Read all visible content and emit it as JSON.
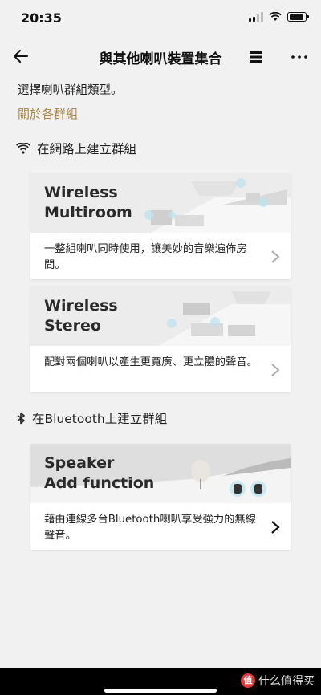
{
  "status": {
    "time": "20:35"
  },
  "nav": {
    "title": "與其他喇叭裝置集合"
  },
  "intro_text": "選擇喇叭群組類型。",
  "about_link": "關於各群組",
  "network_section": {
    "title": "在網路上建立群組",
    "cards": [
      {
        "name": "Wireless\nMultiroom",
        "description": "一整組喇叭同時使用，讓美妙的音樂遍佈房間。"
      },
      {
        "name": "Wireless\nStereo",
        "description": "配對兩個喇叭以產生更寬廣、更立體的聲音。"
      }
    ]
  },
  "bluetooth_section": {
    "title": "在Bluetooth上建立群組",
    "cards": [
      {
        "name": "Speaker\nAdd function",
        "description": "藉由連線多台Bluetooth喇叭享受強力的無線聲音。"
      }
    ]
  },
  "watermark": {
    "badge": "值",
    "text": "什么值得买"
  },
  "colors": {
    "accent_link": "#a8884a",
    "background": "#f1f1f1",
    "card": "#ffffff"
  },
  "icons": [
    "back-arrow-icon",
    "menu-lines-icon",
    "more-dots-icon",
    "wifi-icon",
    "bluetooth-icon",
    "chevron-right-icon"
  ]
}
